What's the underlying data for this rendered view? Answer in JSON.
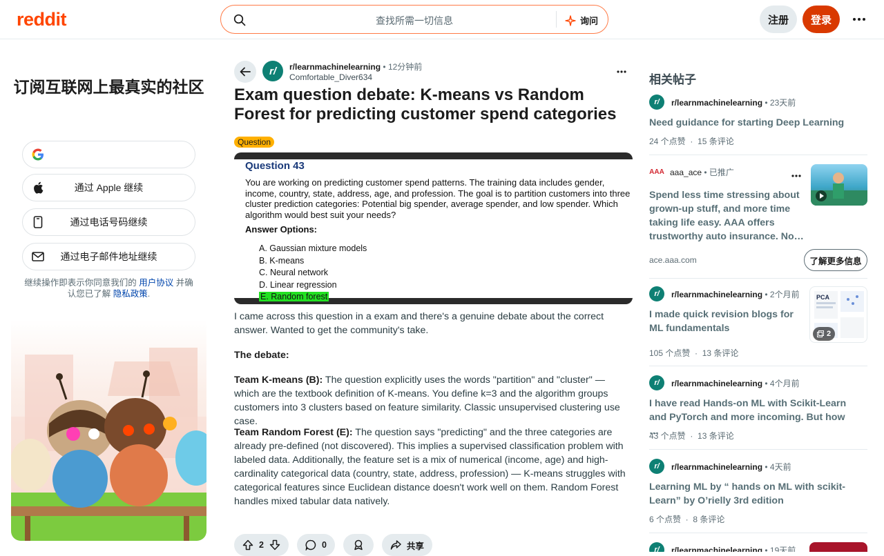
{
  "header": {
    "logo": "reddit",
    "search_placeholder": "查找所需一切信息",
    "ask_label": "询问",
    "signup_label": "注册",
    "login_label": "登录"
  },
  "left_card": {
    "title": "订阅互联网上最真实的社区",
    "apple": "通过 Apple 继续",
    "phone": "通过电话号码继续",
    "email": "通过电子邮件地址继续",
    "legal_prefix": "继续操作即表示你同意我们的",
    "terms": "用户协议",
    "legal_mid": "并确认您已了解",
    "privacy": "隐私政策",
    "legal_end": "."
  },
  "post": {
    "subreddit": "r/learnmachinelearning",
    "time": "12分钟前",
    "author": "Comfortable_Diver634",
    "title": "Exam question debate: K-means vs Random Forest for predicting customer spend categories",
    "flair": "Question",
    "image": {
      "heading": "Question 43",
      "question": "You are working on predicting customer spend patterns. The training data includes gender, income, country, state, address, age, and profession. The goal is to partition customers into three cluster prediction categories: Potential big spender, average spender, and low spender. Which algorithm would best suit your needs?",
      "answer_heading": "Answer Options:",
      "options": [
        "A. Gaussian mixture models",
        "B. K-means",
        "C. Neural network",
        "D. Linear regression",
        "E. Random forest"
      ]
    },
    "p1": "I came across this question in a exam and there's a genuine debate about the correct answer. Wanted to get the community's take.",
    "p2": "The debate:",
    "p3_lead": "Team K-means (B):",
    "p3": " The question explicitly uses the words \"partition\" and \"cluster\" — which are the textbook definition of K-means. You define k=3 and the algorithm groups customers into 3 clusters based on feature similarity. Classic unsupervised clustering use case.",
    "p4_lead": "Team Random Forest (E):",
    "p4": " The question says \"predicting\" and the three categories are already pre-defined (not discovered). This implies a supervised classification problem with labeled data. Additionally, the feature set is a mix of numerical (income, age) and high-cardinality categorical data (country, state, address, profession) — K-means struggles with categorical features since Euclidean distance doesn't work well on them. Random Forest handles mixed tabular data natively.",
    "votes": "2",
    "comments": "0",
    "share": "共享"
  },
  "sidebar": {
    "title": "相关帖子",
    "items": [
      {
        "sub": "r/learnmachinelearning",
        "time": "23天前",
        "title": "Need guidance for starting Deep Learning",
        "upvotes": "24 个点赞",
        "comments": "15 条评论"
      },
      {
        "sub": "aaa_ace",
        "time": "已推广",
        "title": "Spend less time stressing about grown-up stuff, and more time taking life easy. AAA offers trustworthy auto insurance. No…",
        "domain": "ace.aaa.com",
        "cta": "了解更多信息"
      },
      {
        "sub": "r/learnmachinelearning",
        "time": "2个月前",
        "title": "I made quick revision blogs for ML fundamentals",
        "upvotes": "105 个点赞",
        "comments": "13 条评论",
        "gallery_count": "2"
      },
      {
        "sub": "r/learnmachinelearning",
        "time": "4个月前",
        "title": "I have read Hands-on ML with Scikit-Learn and PyTorch and more incoming. But how …",
        "upvotes": "43 个点赞",
        "comments": "13 条评论"
      },
      {
        "sub": "r/learnmachinelearning",
        "time": "4天前",
        "title": "Learning ML by “ hands on ML with scikit-Learn” by O’rielly 3rd edition",
        "upvotes": "6 个点赞",
        "comments": "8 条评论"
      },
      {
        "sub": "r/learnmachinelearning",
        "time": "19天前"
      }
    ]
  },
  "colors": {
    "brand": "#ff4500",
    "login": "#d93900",
    "flair": "#ffb000",
    "subreddit_avatar": "#0e8074"
  }
}
